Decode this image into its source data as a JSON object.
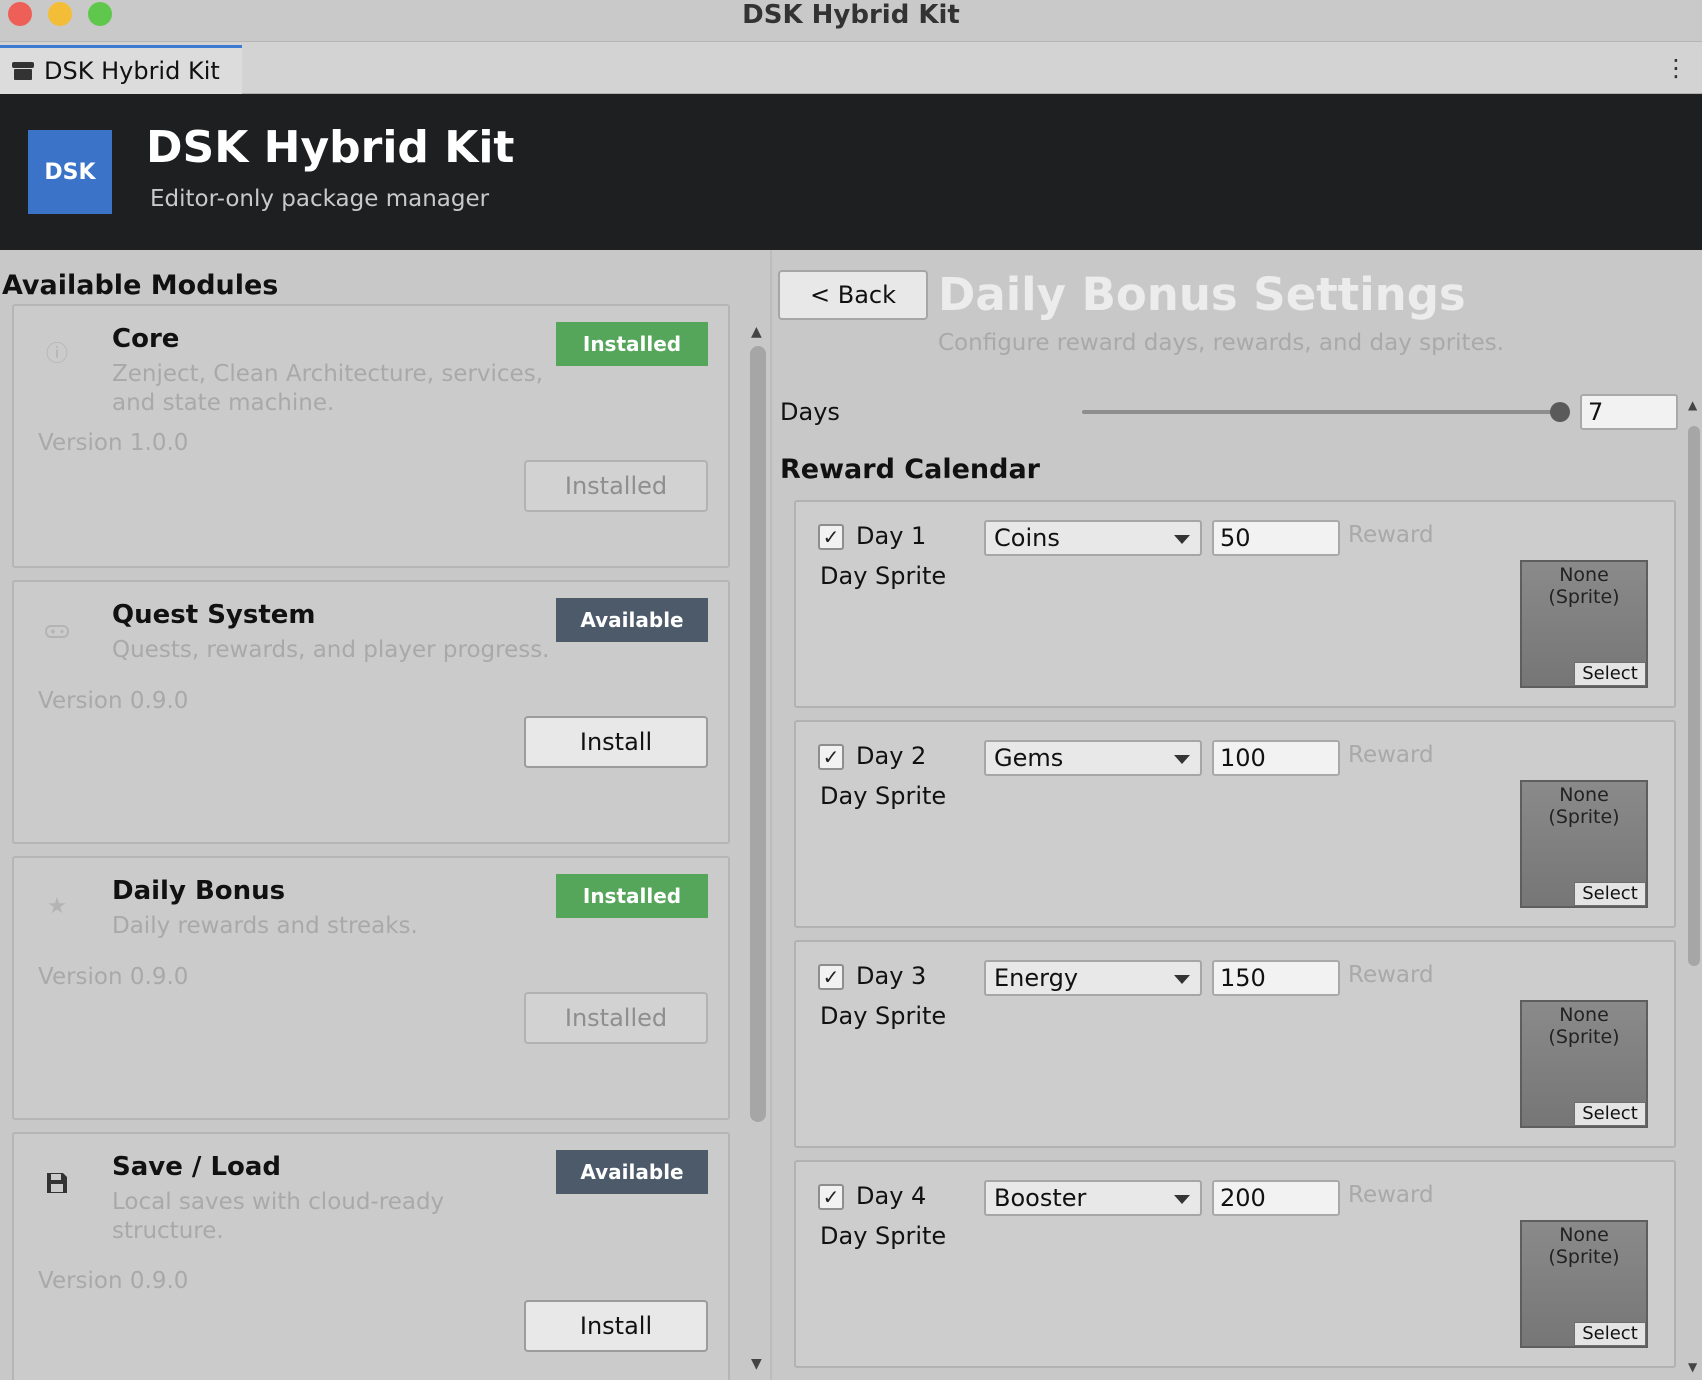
{
  "window": {
    "title": "DSK Hybrid Kit"
  },
  "tab": {
    "label": "DSK Hybrid Kit",
    "icon": "package-icon",
    "menu_icon": "more-vertical-icon"
  },
  "header": {
    "logo_text": "DSK",
    "title": "DSK Hybrid Kit",
    "subtitle": "Editor-only package manager"
  },
  "modules": {
    "title": "Available Modules",
    "items": [
      {
        "name": "Core",
        "description": "Zenject, Clean Architecture, services, and state machine.",
        "version": "Version 1.0.0",
        "status": "Installed",
        "button": "Installed",
        "icon": "info-icon"
      },
      {
        "name": "Quest System",
        "description": "Quests, rewards, and player progress.",
        "version": "Version 0.9.0",
        "status": "Available",
        "button": "Install",
        "icon": "gamepad-icon"
      },
      {
        "name": "Daily Bonus",
        "description": "Daily rewards and streaks.",
        "version": "Version 0.9.0",
        "status": "Installed",
        "button": "Installed",
        "icon": "star-icon"
      },
      {
        "name": "Save / Load",
        "description": "Local saves with cloud-ready structure.",
        "version": "Version 0.9.0",
        "status": "Available",
        "button": "Install",
        "icon": "save-icon"
      }
    ]
  },
  "settings": {
    "back_label": "< Back",
    "title": "Daily Bonus Settings",
    "subtitle": "Configure reward days, rewards, and day sprites.",
    "days_label": "Days",
    "days_value": "7",
    "days_slider_fraction": 1.0,
    "calendar_title": "Reward Calendar",
    "days": [
      {
        "label": "Day 1",
        "checked": true,
        "reward_type": "Coins",
        "amount": "50",
        "reward_label": "Reward",
        "sprite_label": "Day Sprite",
        "sprite_value": "None (Sprite)",
        "sprite_button": "Select"
      },
      {
        "label": "Day 2",
        "checked": true,
        "reward_type": "Gems",
        "amount": "100",
        "reward_label": "Reward",
        "sprite_label": "Day Sprite",
        "sprite_value": "None (Sprite)",
        "sprite_button": "Select"
      },
      {
        "label": "Day 3",
        "checked": true,
        "reward_type": "Energy",
        "amount": "150",
        "reward_label": "Reward",
        "sprite_label": "Day Sprite",
        "sprite_value": "None (Sprite)",
        "sprite_button": "Select"
      },
      {
        "label": "Day 4",
        "checked": true,
        "reward_type": "Booster",
        "amount": "200",
        "reward_label": "Reward",
        "sprite_label": "Day Sprite",
        "sprite_value": "None (Sprite)",
        "sprite_button": "Select"
      }
    ]
  },
  "colors": {
    "installed": "#55a65b",
    "available": "#4d5a6a",
    "logo": "#3a73c8",
    "header_bg": "#1e1f21"
  }
}
